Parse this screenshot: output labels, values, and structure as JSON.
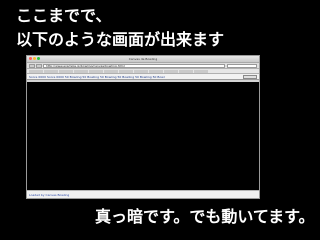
{
  "heading": {
    "line1": "ここまでで、",
    "line2": "以下のような画面が出来ます"
  },
  "browser": {
    "window_title": "Canvas de Bowling",
    "address": "http://www.example.jp/bowling/canvas/bowling.html",
    "toolbar_text": "Score 0000    Score 0000    50 Bowling  50 Bowling  50 Bowling  50 Bowling  50 Bowling  50 Bowl",
    "status_text": "Loaded by Canvas Bowling",
    "colors": {
      "close": "#ff5f57",
      "minimize": "#febc2e",
      "zoom": "#28c840",
      "canvas": "#000000"
    }
  },
  "caption": "真っ暗です。でも動いてます。"
}
